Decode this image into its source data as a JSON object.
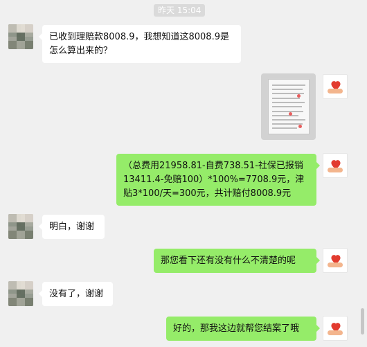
{
  "timestamp": "昨天 15:04",
  "messages": [
    {
      "side": "left",
      "text": "已收到理赔款8008.9，我想知道这8008.9是怎么算出来的？"
    },
    {
      "side": "right",
      "kind": "image"
    },
    {
      "side": "right",
      "text": "（总费用21958.81-自费738.51-社保已报销13411.4-免赔100）*100%=7708.9元，津贴3*100/天=300元，共计赔付8008.9元"
    },
    {
      "side": "left",
      "text": "明白，谢谢"
    },
    {
      "side": "right",
      "text": "那您看下还有没有什么不清楚的呢"
    },
    {
      "side": "left",
      "text": "没有了，谢谢"
    },
    {
      "side": "right",
      "text": "好的，那我这边就帮您结案了哦"
    }
  ]
}
